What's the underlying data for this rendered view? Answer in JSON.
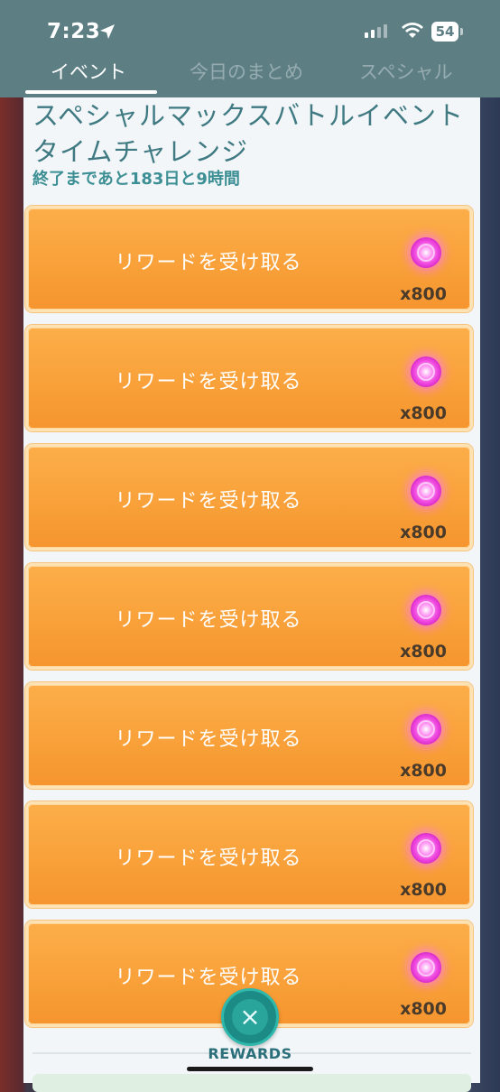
{
  "status_bar": {
    "time": "7:23",
    "battery": "54"
  },
  "tabs": [
    {
      "label": "イベント",
      "active": true
    },
    {
      "label": "今日のまとめ",
      "active": false
    },
    {
      "label": "スペシャル",
      "active": false
    }
  ],
  "challenge": {
    "title": "スペシャルマックスバトルイベントタイムチャレンジ",
    "time_remaining": "終了まであと183日と9時間"
  },
  "rewards": [
    {
      "button_label": "リワードを受け取る",
      "quantity": "x800",
      "icon": "max-particle-orb-icon"
    },
    {
      "button_label": "リワードを受け取る",
      "quantity": "x800",
      "icon": "max-particle-orb-icon"
    },
    {
      "button_label": "リワードを受け取る",
      "quantity": "x800",
      "icon": "max-particle-orb-icon"
    },
    {
      "button_label": "リワードを受け取る",
      "quantity": "x800",
      "icon": "max-particle-orb-icon"
    },
    {
      "button_label": "リワードを受け取る",
      "quantity": "x800",
      "icon": "max-particle-orb-icon"
    },
    {
      "button_label": "リワードを受け取る",
      "quantity": "x800",
      "icon": "max-particle-orb-icon"
    },
    {
      "button_label": "リワードを受け取る",
      "quantity": "x800",
      "icon": "max-particle-orb-icon"
    }
  ],
  "footer": {
    "close_symbol": "×",
    "rewards_label": "REWARDS"
  },
  "colors": {
    "header": "#5d7f84",
    "reward_button": "#f9a13a",
    "accent_teal": "#1c8a85",
    "orb_pink": "#f24ee2"
  }
}
